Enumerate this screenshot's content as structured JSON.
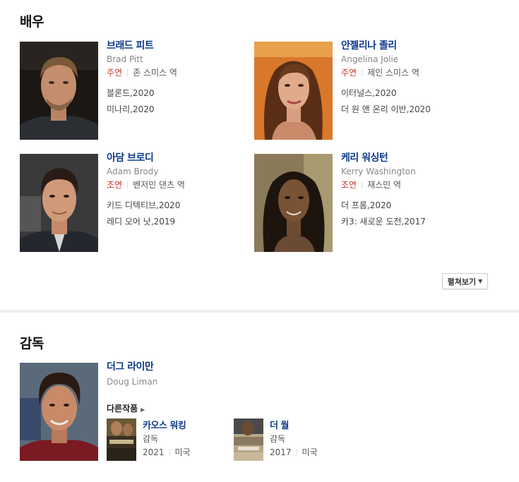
{
  "actors_section": {
    "title": "배우"
  },
  "actors": [
    {
      "name_ko": "브래드 피트",
      "name_en": "Brad Pitt",
      "role_type": "주연",
      "role_name": "존 스미스 역",
      "works": [
        "블론드,2020",
        "미나리,2020"
      ]
    },
    {
      "name_ko": "안젤리나 졸리",
      "name_en": "Angelina Jolie",
      "role_type": "주연",
      "role_name": "제인 스미스 역",
      "works": [
        "이터널스,2020",
        "더 원 앤 온리 이반,2020"
      ]
    },
    {
      "name_ko": "아담 브로디",
      "name_en": "Adam Brody",
      "role_type": "조연",
      "role_name": "벤저민 댄츠 역",
      "works": [
        "키드 디텍티브,2020",
        "레디 오어 낫,2019"
      ]
    },
    {
      "name_ko": "케리 워싱턴",
      "name_en": "Kerry Washington",
      "role_type": "조연",
      "role_name": "재스민 역",
      "works": [
        "더 프롬,2020",
        "카3: 새로운 도전,2017"
      ]
    }
  ],
  "more_button": {
    "label": "펼쳐보기"
  },
  "director_section": {
    "title": "감독"
  },
  "director": {
    "name_ko": "더그 라이만",
    "name_en": "Doug Liman",
    "other_works_label": "다른작품",
    "films": [
      {
        "title": "카오스 워킹",
        "role": "감독",
        "year": "2021",
        "country": "미국"
      },
      {
        "title": "더 월",
        "role": "감독",
        "year": "2017",
        "country": "미국"
      }
    ]
  },
  "colors": {
    "link": "#0d3a8c",
    "role_type": "#c8352d",
    "meta": "#888888"
  }
}
